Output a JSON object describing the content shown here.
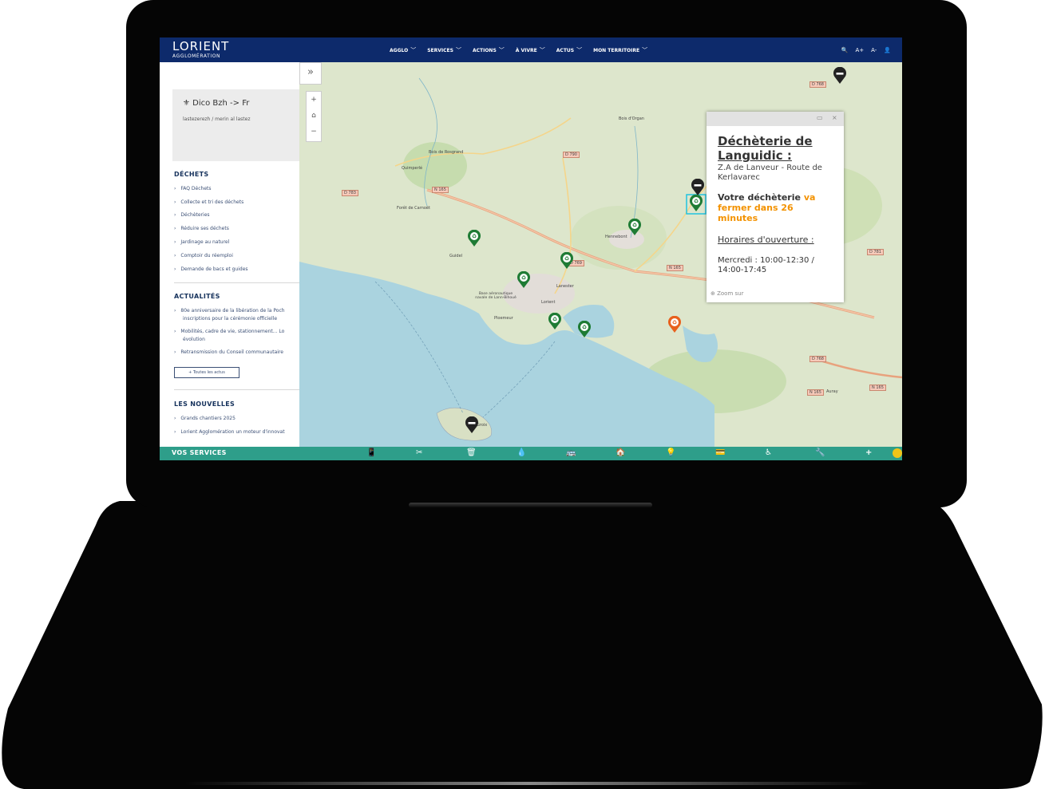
{
  "header": {
    "logo_main": "LORIENT",
    "logo_sub": "AGGLOMÉRATION",
    "nav": [
      {
        "label": "AGGLO"
      },
      {
        "label": "SERVICES"
      },
      {
        "label": "ACTIONS"
      },
      {
        "label": "À VIVRE"
      },
      {
        "label": "ACTUS"
      },
      {
        "label": "MON TERRITOIRE"
      }
    ],
    "tools": {
      "search": "🔍",
      "font_up": "A+",
      "font_down": "A-",
      "account": "👤"
    }
  },
  "sidebar": {
    "dico": {
      "title": "Dico Bzh -> Fr",
      "subtitle": "lastezerezh / merin al lastez"
    },
    "dechets": {
      "title": "DÉCHETS",
      "links": [
        {
          "label": "FAQ Déchets"
        },
        {
          "label": "Collecte et tri des déchets"
        },
        {
          "label": "Déchèteries"
        },
        {
          "label": "Réduire ses déchets"
        },
        {
          "label": "Jardinage au naturel"
        },
        {
          "label": "Comptoir du réemploi"
        },
        {
          "label": "Demande de bacs et guides"
        }
      ]
    },
    "actualites": {
      "title": "ACTUALITÉS",
      "links": [
        {
          "label": "80e anniversaire de la libération de la Poch",
          "label2": "inscriptions pour la cérémonie officielle"
        },
        {
          "label": "Mobilités, cadre de vie, stationnement... Lo",
          "label2": "évolution"
        },
        {
          "label": "Retransmission du Conseil communautaire"
        }
      ],
      "all_button": "+ Toutes les actus"
    },
    "nouvelles": {
      "title": "LES NOUVELLES",
      "links": [
        {
          "label": "Grands chantiers 2025"
        },
        {
          "label": "Lorient Agglomération un moteur d'innovat"
        }
      ]
    }
  },
  "map": {
    "expand": "»",
    "zoom_in": "+",
    "home": "⌂",
    "zoom_out": "−",
    "places": [
      "Quimperlé",
      "Bois de Rosgrand",
      "Forêt de Carnoët",
      "Guidel",
      "Hennebont",
      "Lanester",
      "Lorient",
      "Base aéronautique navale de Lann-Bihoué",
      "Ploemeur",
      "Bois d'Organ",
      "Auray",
      "Groix"
    ],
    "roads": [
      "D 768",
      "D 790",
      "D 783",
      "N 165",
      "D 769",
      "N 165",
      "D 781",
      "D 768",
      "N 165",
      "N 165"
    ]
  },
  "popup": {
    "title": "Déchèterie de Languidic :",
    "address": "Z.A de Lanveur - Route de Kerlavarec",
    "status_prefix": "Votre déchèterie",
    "status_highlight": "va fermer dans 26 minutes",
    "hours_title": "Horaires d'ouverture :",
    "hours_line": "Mercredi : 10:00-12:30 / 14:00-17:45",
    "zoom_link": "Zoom sur",
    "maximize": "▭",
    "close": "×"
  },
  "bottom": {
    "label": "VOS SERVICES",
    "icons": [
      "📱",
      "✂",
      "🗑",
      "💧",
      "🚌",
      "🏠",
      "💡",
      "💳",
      "♿",
      "🔧",
      "+"
    ]
  },
  "colors": {
    "header_bg": "#0d2a6b",
    "services_bar": "#2e9e8a",
    "accent_orange": "#f39200",
    "sea": "#aad3df"
  }
}
